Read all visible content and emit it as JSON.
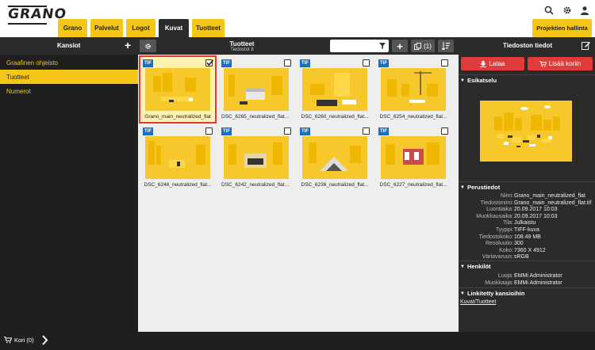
{
  "header": {
    "logo": "GRANO",
    "tabs": [
      {
        "label": "Grano"
      },
      {
        "label": "Palvelut"
      },
      {
        "label": "Logot"
      },
      {
        "label": "Kuvat"
      },
      {
        "label": "Tuotteet"
      }
    ],
    "active_tab": "Kuvat",
    "project_button": "Projektien hallinta",
    "icons": [
      "search-icon",
      "gear-icon",
      "user-icon"
    ]
  },
  "toolbar": {
    "folders_title": "Kansiot",
    "current_folder": "Tuotteet",
    "file_count": "Tiedostot 8",
    "search_value": "",
    "selection_count": "(1)",
    "details_title": "Tiedoston tiedot"
  },
  "folders": [
    {
      "label": "Graafinen ohjeisto",
      "active": false
    },
    {
      "label": "Tuotteet",
      "active": true
    },
    {
      "label": "Numerot",
      "active": false
    }
  ],
  "files": [
    {
      "badge": "TIF",
      "name": "Grano_main_neutralized_flat",
      "selected": true
    },
    {
      "badge": "TIF",
      "name": "DSC_6265_neutralized_flatL...",
      "selected": false
    },
    {
      "badge": "TIF",
      "name": "DSC_6260_neutralized_flat...",
      "selected": false
    },
    {
      "badge": "TIF",
      "name": "DSC_6254_neutralized_flat...",
      "selected": false
    },
    {
      "badge": "TIF",
      "name": "DSC_6246_neutralized_flat...",
      "selected": false
    },
    {
      "badge": "TIF",
      "name": "DSC_6242_neutralized_flatT...",
      "selected": false
    },
    {
      "badge": "TIF",
      "name": "DSC_6236_neutralized_flat...",
      "selected": false
    },
    {
      "badge": "TIF",
      "name": "DSC_6227_neutralized_flat...",
      "selected": false
    }
  ],
  "details": {
    "download_button": "Lataa",
    "add_to_cart_button": "Lisää koriin",
    "preview_title": "Esikatselu",
    "basic_title": "Perustiedot",
    "basic": [
      {
        "key": "Nimi:",
        "value": "Grano_main_neutralized_flat"
      },
      {
        "key": "Tiedostonimi:",
        "value": "Grano_main_neutralized_flat.tif"
      },
      {
        "key": "Luontiaika:",
        "value": "20.09.2017 10:03"
      },
      {
        "key": "Muokkausaika:",
        "value": "20.09.2017 10:03"
      },
      {
        "key": "Tila:",
        "value": "Julkaistu"
      },
      {
        "key": "Tyyppi:",
        "value": "TIFF-kuva"
      },
      {
        "key": "Tiedostokoko:",
        "value": "108.49 MB"
      },
      {
        "key": "Resoluutio:",
        "value": "300"
      },
      {
        "key": "Koko:",
        "value": "7360 X 4912"
      },
      {
        "key": "Väriavaruus:",
        "value": "sRGB"
      }
    ],
    "persons_title": "Henkilöt",
    "persons": [
      {
        "key": "Luoja:",
        "value": "EMMi Administrator"
      },
      {
        "key": "Muokkaaja:",
        "value": "EMMi Administrator"
      }
    ],
    "linked_title": "Linkitetty kansioihin",
    "linked_path": "Kuvat/Tuotteet"
  },
  "footer": {
    "cart_label": "Kori (0)"
  },
  "colors": {
    "accent": "#f5c518",
    "dark": "#2b2b2b",
    "danger": "#e03b3b",
    "badge": "#1a6fc2"
  }
}
